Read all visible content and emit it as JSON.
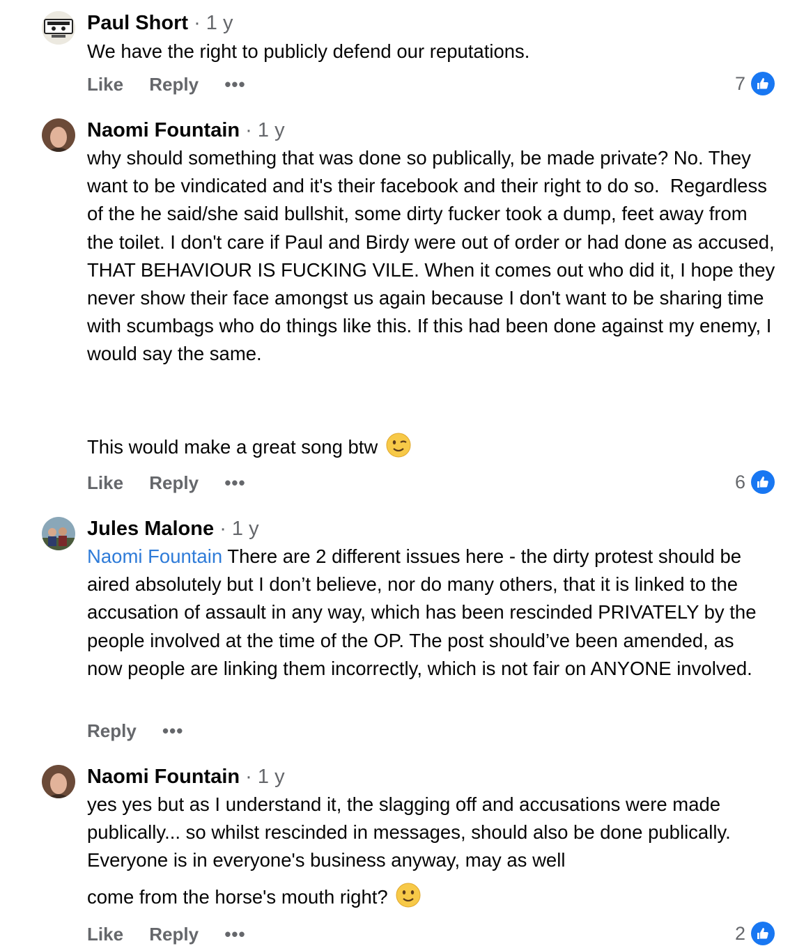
{
  "comments": [
    {
      "name": "Paul Short",
      "time": "· 1 y",
      "text": "We have the right to publicly defend our reputations.",
      "like": "Like",
      "reply": "Reply",
      "more": "•••",
      "likes": "7"
    },
    {
      "name": "Naomi Fountain",
      "time": "· 1 y",
      "text": "why should something that was done so publically, be made private? No. They want to be vindicated and it's their facebook and their right to do so.  Regardless of the he said/she said bullshit, some dirty fucker took a dump, feet away from the toilet. I don't care if Paul and Birdy were out of order or had done as accused, THAT BEHAVIOUR IS FUCKING VILE. When it comes out who did it, I hope they never show their face amongst us again because I don't want to be sharing time with scumbags who do things like this. If this had been done against my enemy, I would say the same.",
      "text2": "This would make a great song btw",
      "like": "Like",
      "reply": "Reply",
      "more": "•••",
      "likes": "6"
    },
    {
      "name": "Jules Malone",
      "time": "· 1 y",
      "mention": "Naomi Fountain",
      "text": " There are 2 different issues here - the dirty protest should be aired absolutely but I don’t believe, nor do many others, that it is linked to the accusation of assault in any way, which has been rescinded PRIVATELY by the people involved at the time of the OP. The post should’ve been amended, as now people are linking them incorrectly, which is not fair on ANYONE involved.",
      "reply": "Reply",
      "more": "•••"
    },
    {
      "name": "Naomi Fountain",
      "time": "· 1 y",
      "text": "yes yes but as I understand it, the slagging off and accusations were made publically... so whilst rescinded in messages, should also be done publically.  Everyone is in everyone's business anyway, may as well",
      "text2": "come from the horse's mouth right?",
      "like": "Like",
      "reply": "Reply",
      "more": "•••",
      "likes": "2"
    }
  ],
  "icons": {
    "like": "thumbs-up-icon",
    "wink": "winking-face-emoji",
    "smile": "slightly-smiling-face-emoji"
  },
  "colors": {
    "accent": "#1877f2",
    "mention": "#2e7bd8",
    "muted": "#65676b"
  }
}
